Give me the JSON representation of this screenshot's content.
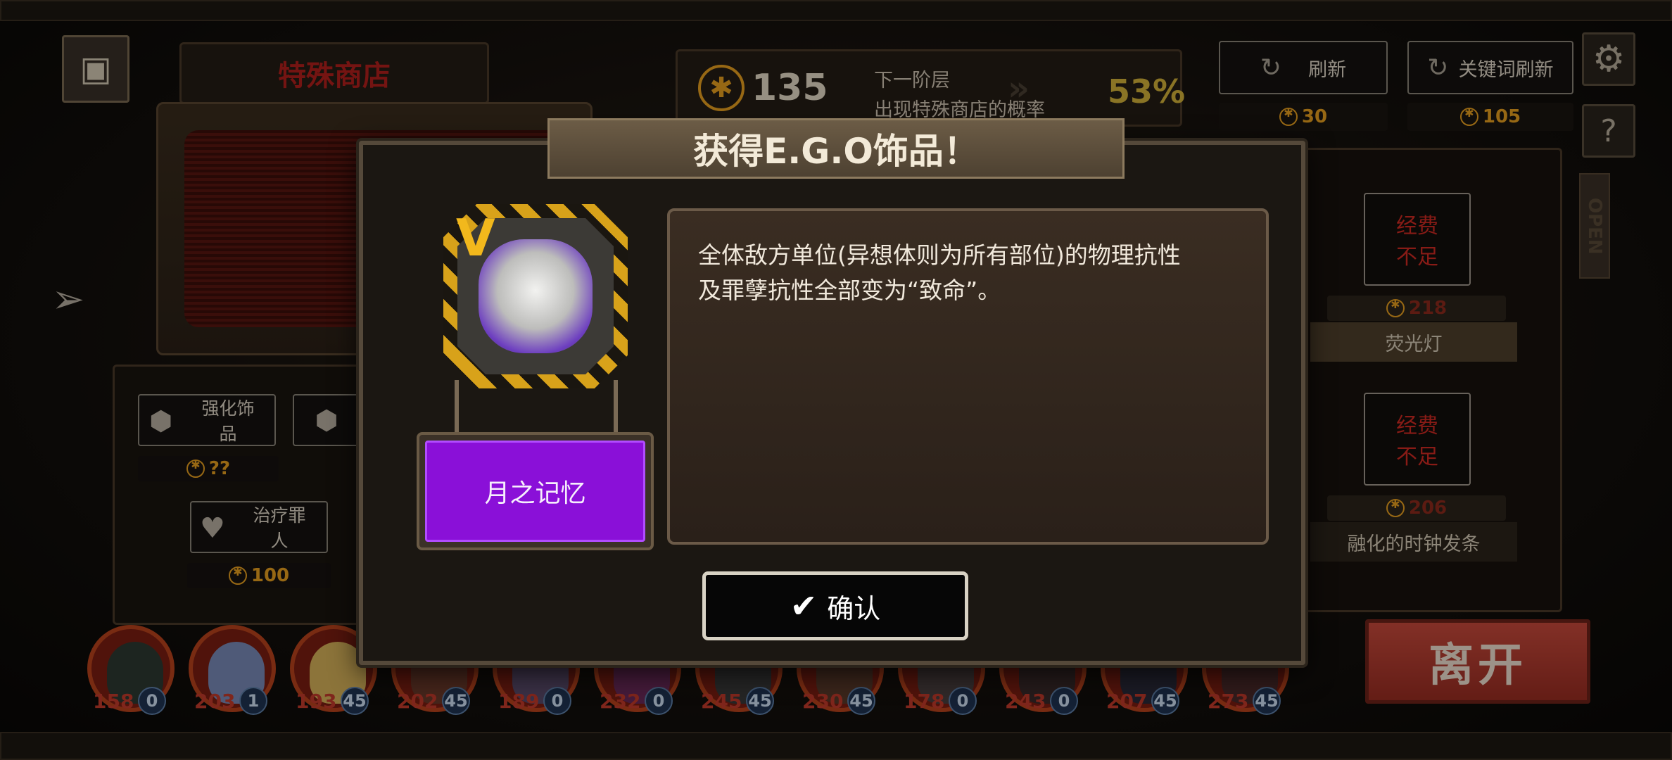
{
  "shop": {
    "title": "特殊商店",
    "coins": "135",
    "next_layer_line1": "下一阶层",
    "next_layer_line2": "出现特殊商店的概率",
    "special_shop_chance": "53%",
    "refresh_label": "刷新",
    "refresh_cost": "30",
    "keyword_refresh_label": "关键词刷新",
    "keyword_refresh_cost": "105",
    "enhance_label_line1": "强化饰",
    "enhance_label_line2": "品",
    "enhance_cost": "??",
    "heal_label_line1": "治疗罪",
    "heal_label_line2": "人",
    "heal_cost": "100",
    "open_sign": "OPEN",
    "leave_label": "离开"
  },
  "items": [
    {
      "status_line1": "经费",
      "status_line2": "不足",
      "cost": "218",
      "name": "荧光灯"
    },
    {
      "status_line1": "经费",
      "status_line2": "不足",
      "cost": "206",
      "name": "融化的时钟发条"
    }
  ],
  "modal": {
    "title": "获得E.G.O饰品！",
    "tier": "V",
    "gift_name": "月之记忆",
    "description_line1": "全体敌方单位(异想体则为所有部位)的物理抗性",
    "description_line2": "及罪孽抗性全部变为“致命”。",
    "confirm_label": "确认"
  },
  "party": [
    {
      "hp": "158",
      "sp": "0"
    },
    {
      "hp": "203",
      "sp": "1"
    },
    {
      "hp": "193",
      "sp": "45"
    },
    {
      "hp": "202",
      "sp": "45"
    },
    {
      "hp": "189",
      "sp": "0"
    },
    {
      "hp": "232",
      "sp": "0"
    },
    {
      "hp": "245",
      "sp": "45"
    },
    {
      "hp": "230",
      "sp": "45"
    },
    {
      "hp": "178",
      "sp": "0"
    },
    {
      "hp": "243",
      "sp": "0"
    },
    {
      "hp": "207",
      "sp": "45"
    },
    {
      "hp": "273",
      "sp": "45"
    }
  ],
  "colors": {
    "coin": "#e9a020",
    "gift_rarity": "#8a10d8",
    "shop_title": "#b3201c",
    "chance": "#d4b23a",
    "leave": "#c94a3c"
  }
}
